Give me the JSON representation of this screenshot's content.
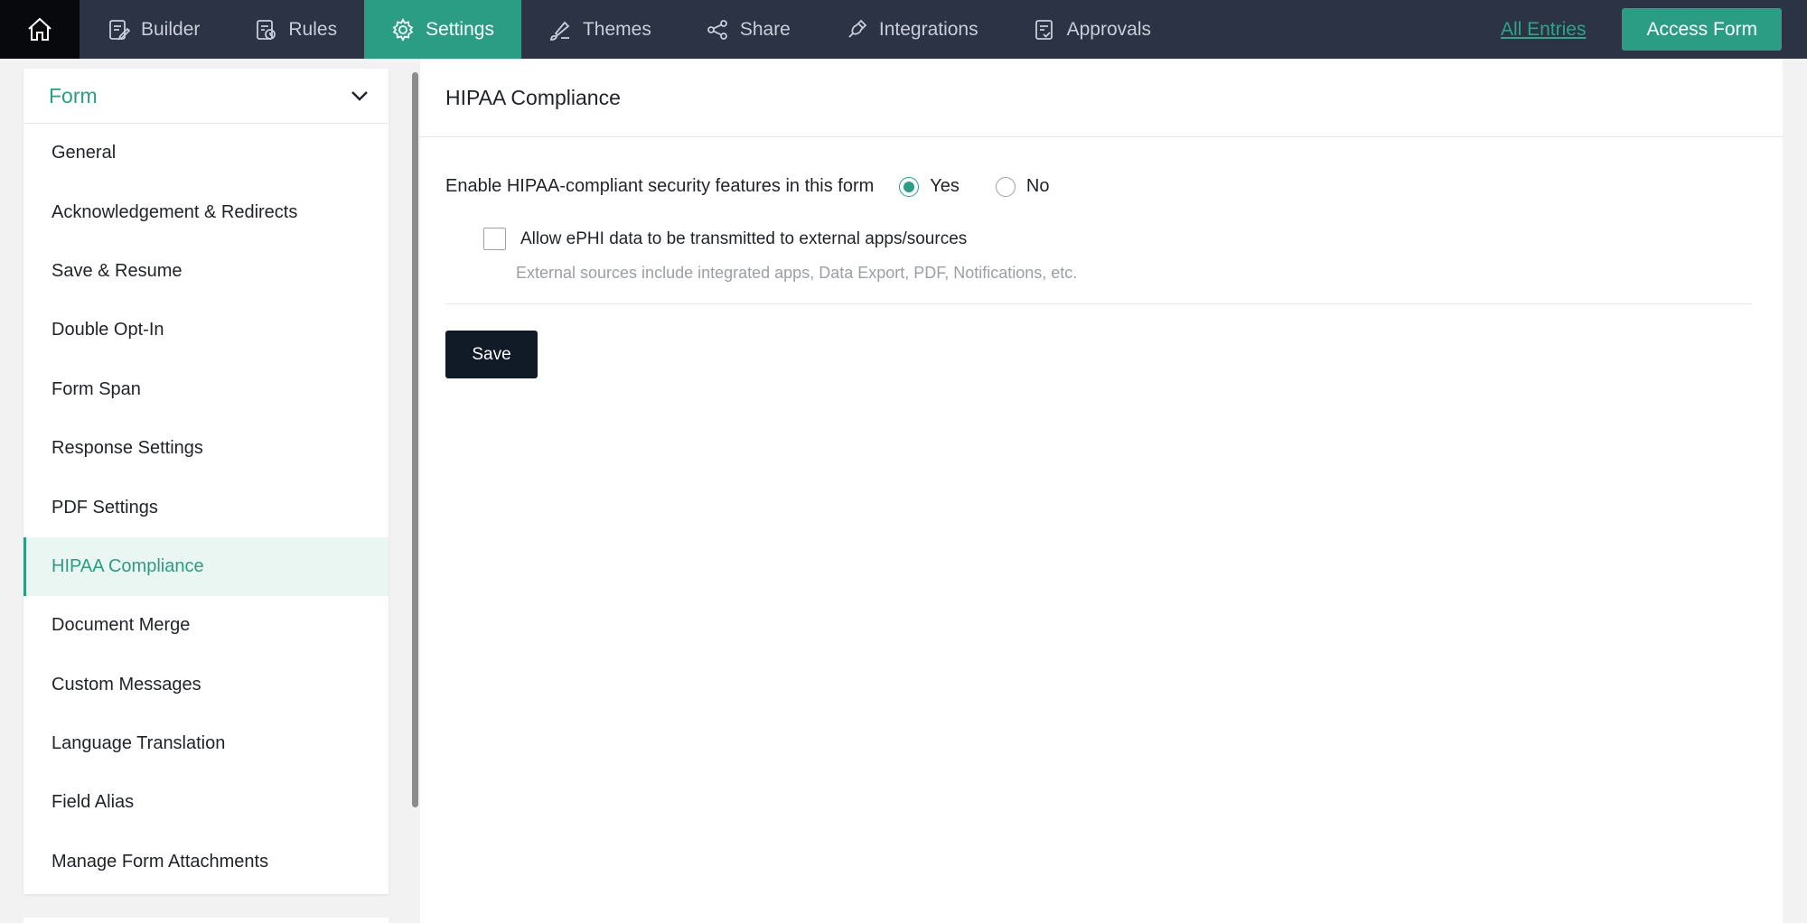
{
  "nav": {
    "items": [
      {
        "label": "Builder",
        "icon": "builder-icon"
      },
      {
        "label": "Rules",
        "icon": "rules-icon"
      },
      {
        "label": "Settings",
        "icon": "gear-icon"
      },
      {
        "label": "Themes",
        "icon": "brush-icon"
      },
      {
        "label": "Share",
        "icon": "share-icon"
      },
      {
        "label": "Integrations",
        "icon": "puzzle-icon"
      },
      {
        "label": "Approvals",
        "icon": "approvals-icon"
      }
    ],
    "active": "Settings",
    "all_entries": "All Entries",
    "access_form": "Access Form"
  },
  "sidebar": {
    "title": "Form",
    "items": [
      "General",
      "Acknowledgement & Redirects",
      "Save & Resume",
      "Double Opt-In",
      "Form Span",
      "Response Settings",
      "PDF Settings",
      "HIPAA Compliance",
      "Document Merge",
      "Custom Messages",
      "Language Translation",
      "Field Alias",
      "Manage Form Attachments"
    ],
    "active": "HIPAA Compliance"
  },
  "main": {
    "title": "HIPAA Compliance",
    "enable_label": "Enable HIPAA-compliant security features in this form",
    "options": {
      "yes": "Yes",
      "no": "No"
    },
    "selected": "Yes",
    "allow_label": "Allow ePHI data to be transmitted to external apps/sources",
    "allow_checked": false,
    "helper": "External sources include integrated apps, Data Export, PDF, Notifications, etc.",
    "save_label": "Save"
  },
  "colors": {
    "accent": "#2a9d84",
    "topbar": "#2b3344",
    "save": "#111a27"
  }
}
